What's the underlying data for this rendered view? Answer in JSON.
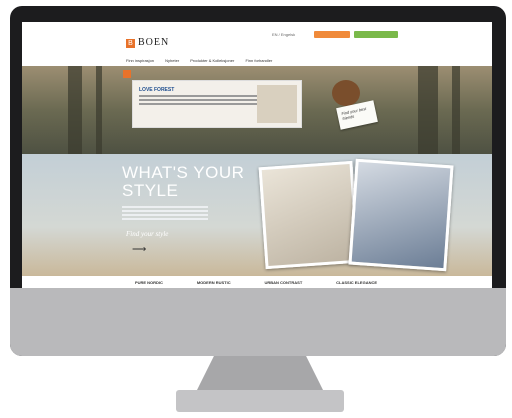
{
  "brand": {
    "logo_mark": "B",
    "name": "BOEN"
  },
  "header": {
    "language": "EN / Engelsk"
  },
  "nav": {
    "items": [
      "Finn inspirasjon",
      "Nyheter",
      "Produkter & Kolleksjoner",
      "Finn forhandler"
    ]
  },
  "hero": {
    "box_title": "LOVE FOREST",
    "note_text": "Find your best friends"
  },
  "style_section": {
    "title_line1": "WHAT'S YOUR",
    "title_line2": "STYLE",
    "cta": "Find your style",
    "tabs": [
      "PURE NORDIC",
      "MODERN RUSTIC",
      "URBAN CONTRAST",
      "CLASSIC ELEGANCE"
    ]
  },
  "colors": {
    "accent": "#e8722a",
    "cta_orange": "#f08a3a",
    "cta_green": "#7ab94a"
  }
}
